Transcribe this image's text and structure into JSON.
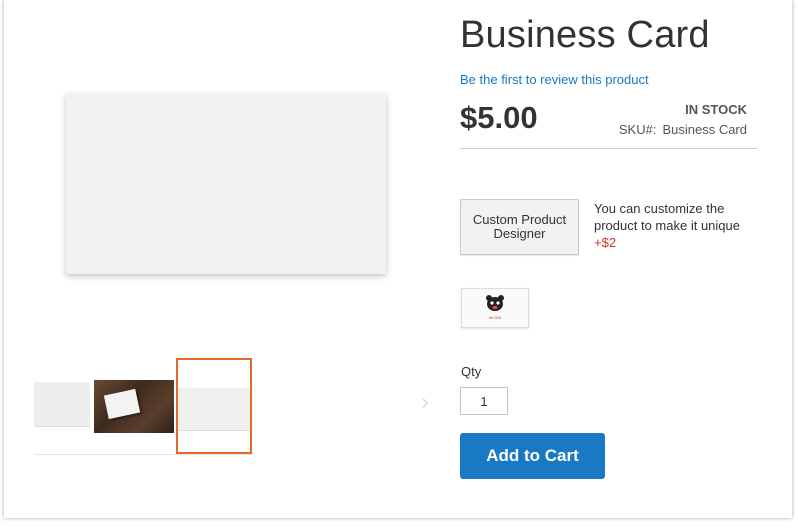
{
  "product": {
    "title": "Business Card",
    "review_link": "Be the first to review this product",
    "price": "$5.00",
    "stock_status": "In stock",
    "sku_label": "SKU#:",
    "sku_value": "Business Card"
  },
  "designer": {
    "button_label": "Custom Product Designer",
    "note": "You can customize the product to make it unique",
    "extra_price": "+$2"
  },
  "preview": {
    "label": "## 000"
  },
  "cart": {
    "qty_label": "Qty",
    "qty_value": "1",
    "add_to_cart_label": "Add to Cart"
  },
  "gallery": {
    "next_arrow_icon": "chevron-right-icon",
    "active_thumb_index": 2
  },
  "colors": {
    "accent": "#1979c3",
    "active_thumb_border": "#e36a2a",
    "extra_price": "#e02b27"
  }
}
